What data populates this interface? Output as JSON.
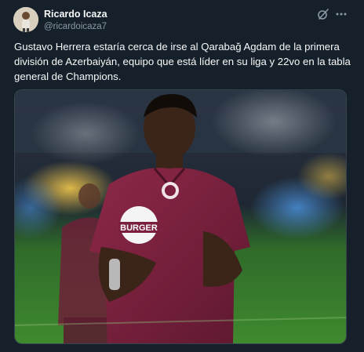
{
  "author": {
    "display_name": "Ricardo Icaza",
    "handle": "@ricardoicaza7",
    "avatar_icon": "user-avatar"
  },
  "header_actions": {
    "grok_icon": "grok-icon",
    "more_icon": "more-options-icon"
  },
  "tweet": {
    "text": "Gustavo Herrera estaría cerca de irse al Qarabağ Agdam de la primera división de Azerbaiyán, equipo que está líder en su liga y 22vo en la tabla general de Champions."
  },
  "media": {
    "shirt_sponsor": "BURGER",
    "colors": {
      "jersey": "#7a1f3d",
      "pitch": "#3f8a2e",
      "stands": "#1c2a3a"
    }
  },
  "theme": {
    "background": "#15202b",
    "text": "#f7f9f9",
    "secondary": "#8b98a5",
    "border": "#38444d"
  }
}
